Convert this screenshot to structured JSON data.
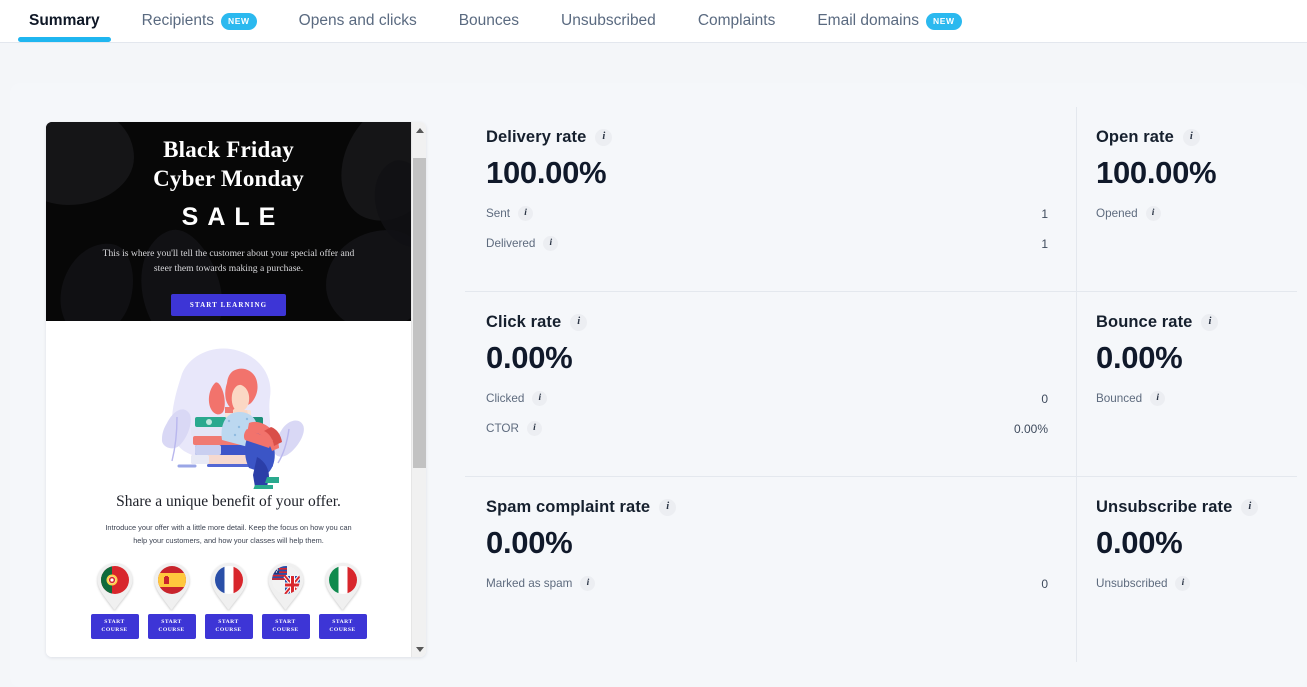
{
  "tabs": [
    {
      "label": "Summary",
      "active": true,
      "badge": null
    },
    {
      "label": "Recipients",
      "active": false,
      "badge": "NEW"
    },
    {
      "label": "Opens and clicks",
      "active": false,
      "badge": null
    },
    {
      "label": "Bounces",
      "active": false,
      "badge": null
    },
    {
      "label": "Unsubscribed",
      "active": false,
      "badge": null
    },
    {
      "label": "Complaints",
      "active": false,
      "badge": null
    },
    {
      "label": "Email domains",
      "active": false,
      "badge": "NEW"
    }
  ],
  "preview": {
    "hero": {
      "title_line1": "Black Friday",
      "title_line2": "Cyber Monday",
      "sale": "SALE",
      "subtitle": "This is where you'll tell the customer about your special offer and steer them towards making a purchase.",
      "cta": "START LEARNING"
    },
    "body": {
      "heading": "Share a unique benefit of your offer.",
      "text": "Introduce your offer with a little more detail. Keep the focus on how you can help your customers, and how your classes will help them.",
      "course_button": "START\nCOURSE",
      "flags": [
        {
          "name": "portugal-flag-icon"
        },
        {
          "name": "spain-flag-icon"
        },
        {
          "name": "france-flag-icon"
        },
        {
          "name": "uk-us-flag-icon"
        },
        {
          "name": "italy-flag-icon"
        }
      ]
    }
  },
  "metrics": {
    "delivery": {
      "title": "Delivery rate",
      "value": "100.00%",
      "stats": [
        {
          "label": "Sent",
          "value": "1"
        },
        {
          "label": "Delivered",
          "value": "1"
        }
      ]
    },
    "open": {
      "title": "Open rate",
      "value": "100.00%",
      "stats": [
        {
          "label": "Opened",
          "value": ""
        }
      ]
    },
    "click": {
      "title": "Click rate",
      "value": "0.00%",
      "stats": [
        {
          "label": "Clicked",
          "value": "0"
        },
        {
          "label": "CTOR",
          "value": "0.00%"
        }
      ]
    },
    "bounce": {
      "title": "Bounce rate",
      "value": "0.00%",
      "stats": [
        {
          "label": "Bounced",
          "value": ""
        }
      ]
    },
    "spam": {
      "title": "Spam complaint rate",
      "value": "0.00%",
      "stats": [
        {
          "label": "Marked as spam",
          "value": "0"
        }
      ]
    },
    "unsubscribe": {
      "title": "Unsubscribe rate",
      "value": "0.00%",
      "stats": [
        {
          "label": "Unsubscribed",
          "value": ""
        }
      ]
    }
  },
  "colors": {
    "accent": "#1fb6f0",
    "badge": "#2bb9ef",
    "cta": "#3d35d6",
    "page_bg": "#f4f6f9"
  },
  "icons": {
    "info": "i"
  }
}
